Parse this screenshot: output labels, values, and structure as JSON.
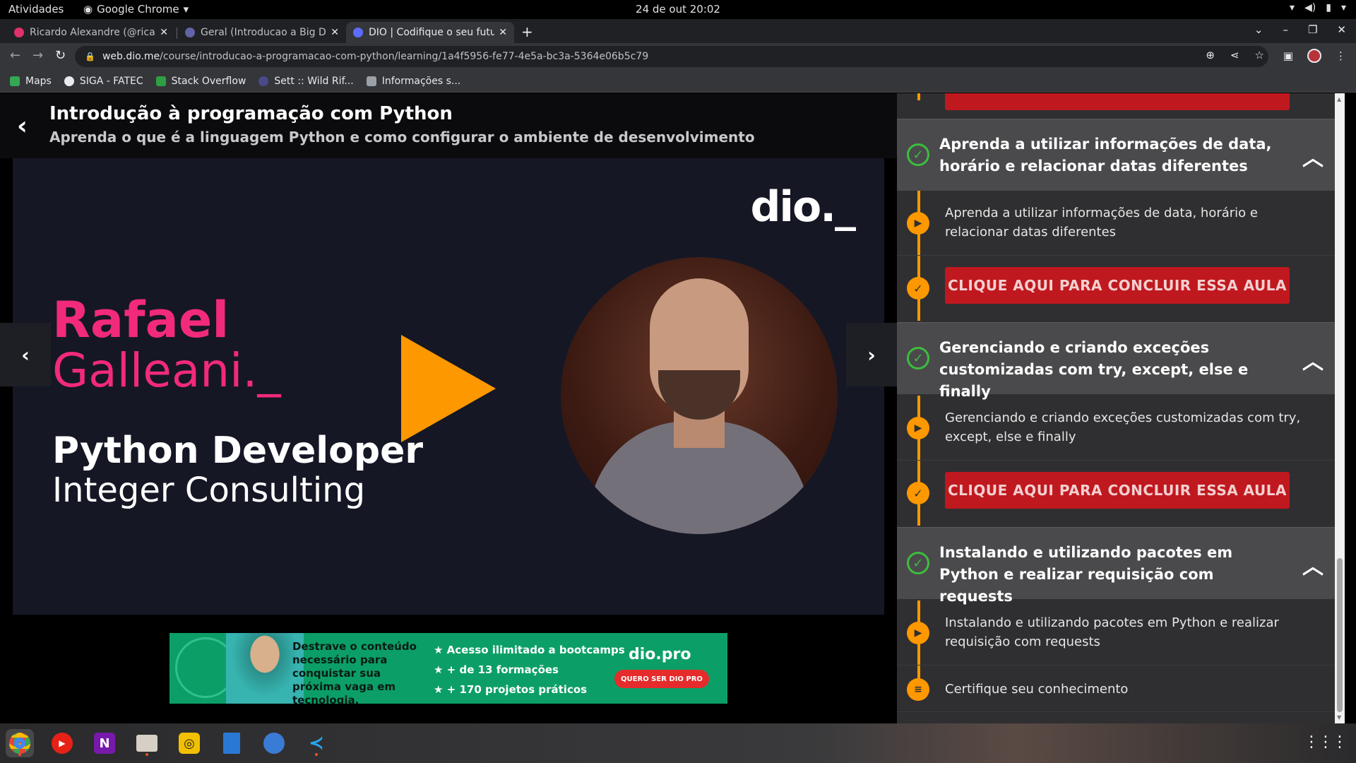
{
  "system": {
    "activities": "Atividades",
    "app_menu": "Google Chrome",
    "clock": "24 de out  20:02"
  },
  "tabs": [
    {
      "title": "Ricardo Alexandre (@rica",
      "favicon_color": "#e1306c"
    },
    {
      "title": "Geral (Introducao a Big D",
      "favicon_color": "#6264a7"
    },
    {
      "title": "DIO | Codifique o seu futu",
      "favicon_color": "#5b6cff"
    }
  ],
  "omnibox": {
    "host": "web.dio.me",
    "path": "/course/introducao-a-programacao-com-python/learning/1a4f5956-fe77-4e5a-bc3a-5364e06b5c79"
  },
  "bookmarks": [
    {
      "label": "Maps",
      "color": "#34a853"
    },
    {
      "label": "SIGA - FATEC",
      "color": "#e8eaed"
    },
    {
      "label": "Stack Overflow",
      "color": "#2ea043"
    },
    {
      "label": "Sett :: Wild Rif...",
      "color": "#4a4a8a"
    },
    {
      "label": "Informações s...",
      "color": "#9aa0a6"
    }
  ],
  "course": {
    "title": "Introdução à programação com Python",
    "subtitle": "Aprenda o que é a linguagem Python e como configurar o ambiente de desenvolvimento"
  },
  "video": {
    "logo": "dio._",
    "first_name": "Rafael",
    "last_name": "Galleani._",
    "role": "Python Developer",
    "company": "Integer Consulting"
  },
  "promo": {
    "text": "Destrave o conteúdo necessário para conquistar sua próxima vaga em tecnologia.",
    "bullets": [
      "Acesso ilimitado a bootcamps",
      "+ de 13 formações",
      "+ 170 projetos práticos"
    ],
    "logo": "dio.pro",
    "button": "QUERO SER DIO PRO"
  },
  "sidebar": {
    "modules": [
      {
        "title": "Aprenda a utilizar informações de data, horário e relacionar datas diferentes",
        "lesson": "Aprenda a utilizar informações de data, horário e relacionar datas diferentes",
        "conclude": "CLIQUE AQUI PARA CONCLUIR ESSA AULA"
      },
      {
        "title": "Gerenciando e criando exceções customizadas com try, except, else e finally",
        "lesson": "Gerenciando e criando exceções customizadas com try, except, else e finally",
        "conclude": "CLIQUE AQUI PARA CONCLUIR ESSA AULA"
      },
      {
        "title": "Instalando e utilizando pacotes em Python e realizar requisição com requests",
        "lesson": "Instalando e utilizando pacotes em Python e realizar requisição com requests",
        "quiz": "Certifique seu conhecimento"
      }
    ]
  },
  "colors": {
    "accent_orange": "#fe9800",
    "conclude_red": "#c0181f",
    "check_green": "#3dbd3d",
    "speaker_pink": "#f22a7a"
  }
}
